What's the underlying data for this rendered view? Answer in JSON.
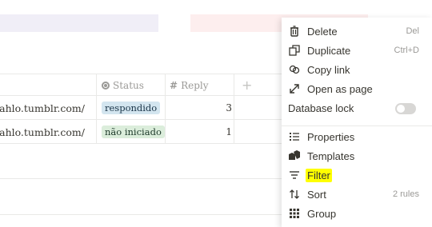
{
  "table": {
    "columns": [
      {
        "name": "status",
        "label": "Status",
        "icon": "status-icon"
      },
      {
        "name": "reply",
        "label": "Reply",
        "icon": "hash-icon"
      }
    ],
    "rows": [
      {
        "url": "xkahlo.tumblr.com/",
        "status": "respondido",
        "status_color": "#d3e5ef",
        "reply": "3"
      },
      {
        "url": "xkahlo.tumblr.com/",
        "status": "não iniciado",
        "status_color": "#dbeddb",
        "reply": "1"
      }
    ]
  },
  "menu": {
    "items": [
      {
        "label": "Delete",
        "hint": "Del",
        "icon": "trash-icon"
      },
      {
        "label": "Duplicate",
        "hint": "Ctrl+D",
        "icon": "duplicate-icon"
      },
      {
        "label": "Copy link",
        "hint": "",
        "icon": "link-icon"
      },
      {
        "label": "Open as page",
        "hint": "",
        "icon": "open-page-icon"
      },
      {
        "label": "Database lock",
        "hint": "",
        "icon": ""
      },
      {
        "label": "Properties",
        "hint": "",
        "icon": "properties-icon"
      },
      {
        "label": "Templates",
        "hint": "",
        "icon": "templates-icon"
      },
      {
        "label": "Filter",
        "hint": "",
        "icon": "filter-icon",
        "highlighted": true
      },
      {
        "label": "Sort",
        "hint": "2 rules",
        "icon": "sort-icon"
      },
      {
        "label": "Group",
        "hint": "",
        "icon": "group-icon"
      }
    ]
  },
  "colors": {
    "highlight": "#ffff00",
    "band_lavender": "#f0eef7",
    "band_pink": "#fdeeee"
  }
}
